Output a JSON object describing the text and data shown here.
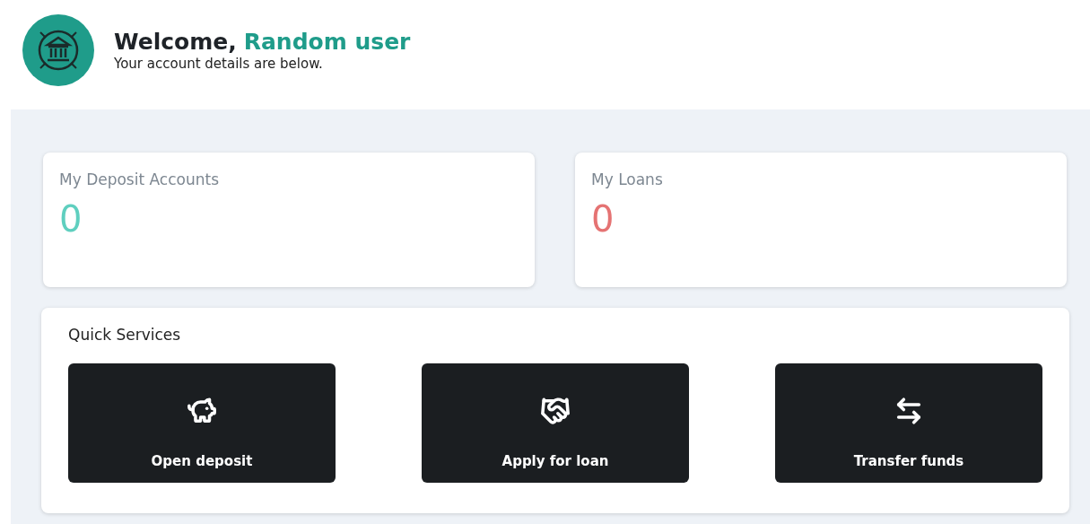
{
  "header": {
    "greeting": "Welcome,",
    "user_name": "Random user",
    "subtitle": "Your account details are below."
  },
  "stats": [
    {
      "label": "My Deposit Accounts",
      "value": "0",
      "color": "#5fcfbf"
    },
    {
      "label": "My Loans",
      "value": "0",
      "color": "#e57373"
    }
  ],
  "quick_services": {
    "title": "Quick Services",
    "items": [
      {
        "label": "Open deposit",
        "kind": "piggy"
      },
      {
        "label": "Apply for loan",
        "kind": "handshake"
      },
      {
        "label": "Transfer funds",
        "kind": "transfer"
      }
    ]
  }
}
